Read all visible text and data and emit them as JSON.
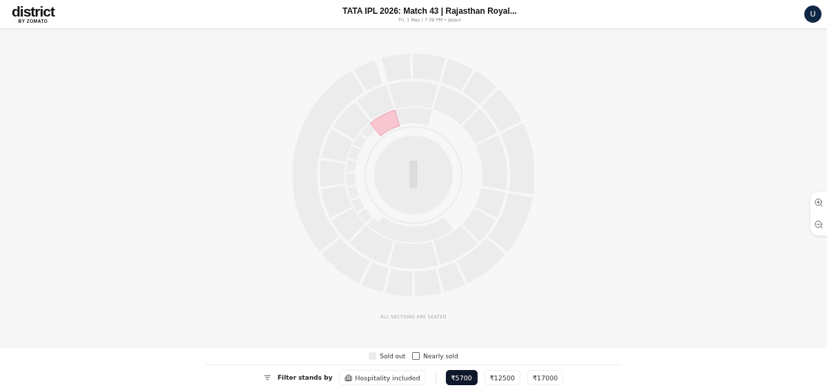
{
  "header": {
    "logo": "district",
    "logo_tagline": "BY ZOMATO",
    "title": "TATA IPL 2026: Match 43 | Rajasthan Royal...",
    "subtitle": "Fri, 1 May | 7:30 PM • Jaipur",
    "avatar": "U"
  },
  "map": {
    "note": "ALL SECTIONS ARE SEATED"
  },
  "legend": [
    {
      "label": "Sold out",
      "kind": "sold_out"
    },
    {
      "label": "Nearly sold",
      "kind": "nearly_sold"
    }
  ],
  "filter": {
    "label": "Filter stands by",
    "hospitality": "Hospitality included",
    "prices": [
      {
        "label": "₹5700",
        "selected": true
      },
      {
        "label": "₹12500",
        "selected": false
      },
      {
        "label": "₹17000",
        "selected": false
      }
    ]
  }
}
